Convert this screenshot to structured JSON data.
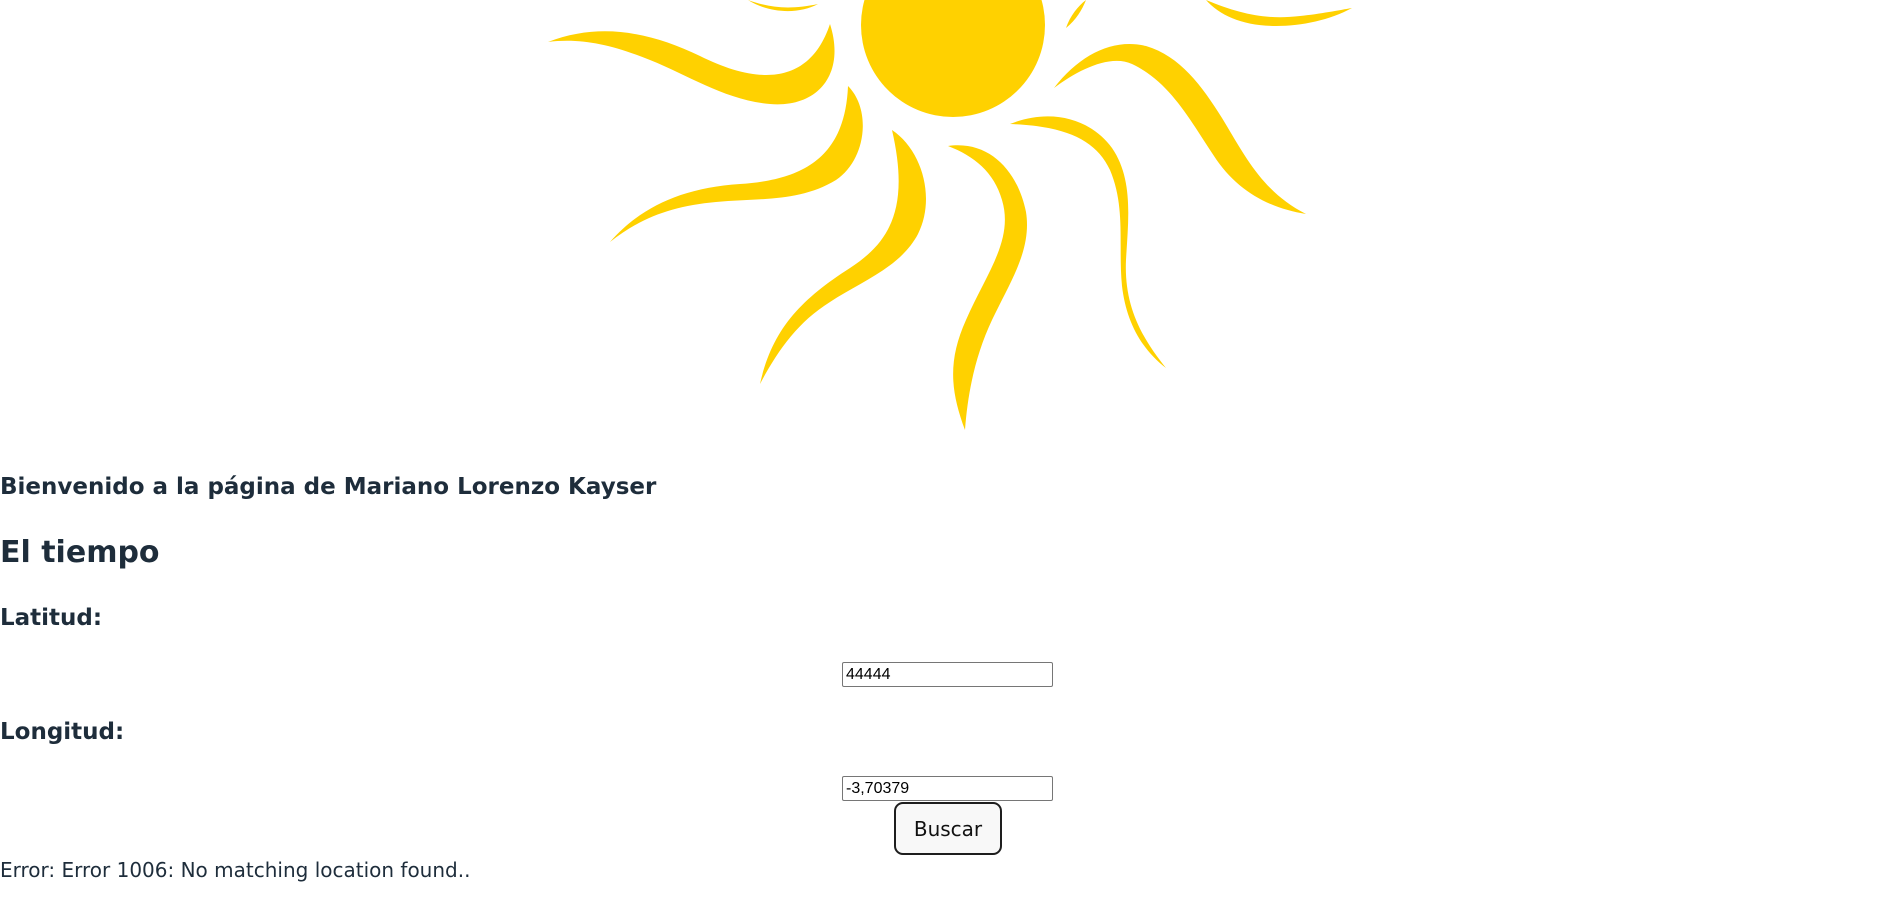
{
  "header": {
    "logo_icon": "sun-icon",
    "sun_color": "#FFD100"
  },
  "main": {
    "welcome": "Bienvenido a la página de Mariano Lorenzo Kayser",
    "title": "El tiempo",
    "latitude_label": "Latitud:",
    "latitude_value": "44444",
    "longitude_label": "Longitud:",
    "longitude_value": "-3,70379",
    "search_button": "Buscar",
    "error_message": "Error: Error 1006: No matching location found.."
  },
  "colors": {
    "text": "#1e2d3b",
    "background": "#ffffff"
  }
}
